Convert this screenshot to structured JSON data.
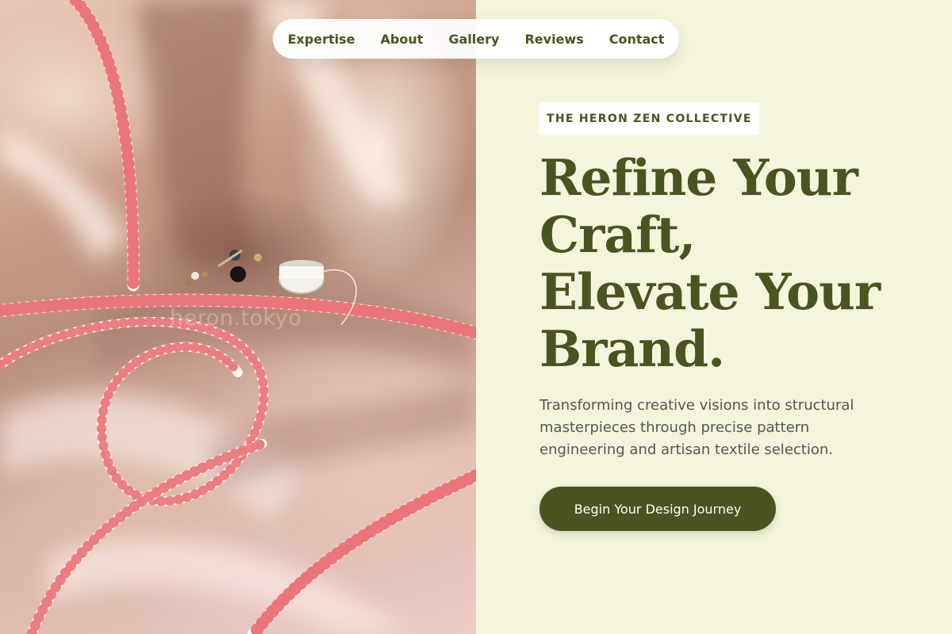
{
  "nav": {
    "items": [
      {
        "label": "Expertise"
      },
      {
        "label": "About"
      },
      {
        "label": "Gallery"
      },
      {
        "label": "Reviews"
      },
      {
        "label": "Contact"
      }
    ]
  },
  "hero_image": {
    "watermark": "heron.tokyo"
  },
  "hero": {
    "eyebrow": "THE HERON ZEN COLLECTIVE",
    "headline_lines": [
      "Refine Your",
      "Craft,",
      "Elevate Your",
      "Brand."
    ],
    "lede": "Transforming creative visions into structural masterpieces through precise pattern engineering and artisan textile selection.",
    "cta_label": "Begin Your Design Journey"
  },
  "colors": {
    "accent": "#4a5420",
    "background": "#f4f5dc",
    "body_text": "#555555"
  }
}
